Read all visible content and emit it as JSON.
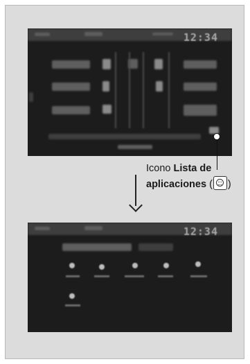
{
  "screens": {
    "top": {
      "clock": "12:34"
    },
    "bottom": {
      "clock": "12:34"
    }
  },
  "callout": {
    "prefix": "Icono ",
    "bold_line1": "Lista de",
    "bold_line2": "aplicaciones",
    "open_paren": " (",
    "close_paren": ")",
    "icon": "app-list-icon"
  },
  "arrow": {
    "icon": "down-arrow-icon"
  }
}
